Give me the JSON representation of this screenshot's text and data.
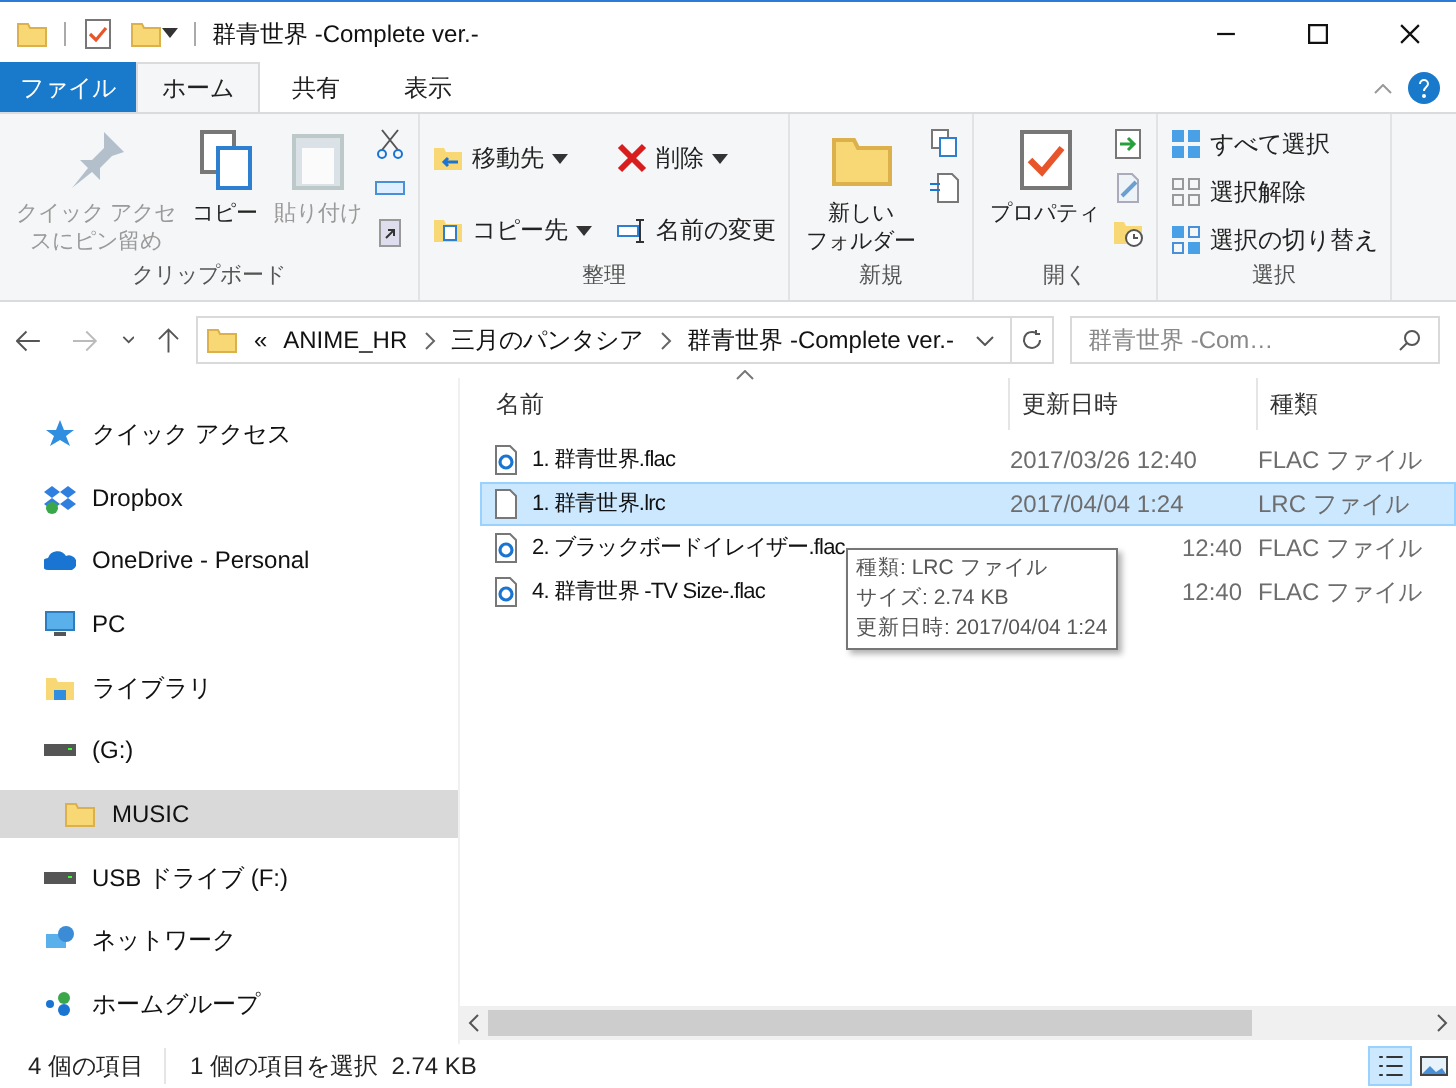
{
  "window": {
    "title": "群青世界 -Complete ver.-"
  },
  "ribbon_tabs": [
    {
      "label": "ファイル",
      "kind": "file",
      "selected": false
    },
    {
      "label": "ホーム",
      "kind": "tab",
      "selected": true
    },
    {
      "label": "共有",
      "kind": "tab",
      "selected": false
    },
    {
      "label": "表示",
      "kind": "tab",
      "selected": false
    }
  ],
  "ribbon_groups": [
    {
      "label": "クリップボード",
      "items": [
        {
          "kind": "large",
          "lines": [
            "クイック アクセ",
            "スにピン留め"
          ],
          "disabled": true
        },
        {
          "kind": "large",
          "lines": [
            "コピー"
          ],
          "disabled": false
        },
        {
          "kind": "large",
          "lines": [
            "貼り付け"
          ],
          "disabled": true
        }
      ]
    },
    {
      "label": "整理",
      "items": [
        {
          "kind": "small",
          "label": "移動先",
          "dropdown": true
        },
        {
          "kind": "small",
          "label": "削除",
          "dropdown": true
        },
        {
          "kind": "small",
          "label": "コピー先",
          "dropdown": true
        },
        {
          "kind": "small",
          "label": "名前の変更",
          "dropdown": false
        }
      ]
    },
    {
      "label": "新規",
      "items": [
        {
          "kind": "large",
          "lines": [
            "新しい",
            "フォルダー"
          ],
          "disabled": false
        }
      ]
    },
    {
      "label": "開く",
      "items": [
        {
          "kind": "large",
          "lines": [
            "プロパティ"
          ],
          "disabled": false
        }
      ]
    },
    {
      "label": "選択",
      "items": [
        {
          "kind": "small",
          "label": "すべて選択",
          "dropdown": false
        },
        {
          "kind": "small",
          "label": "選択解除",
          "dropdown": false
        },
        {
          "kind": "small",
          "label": "選択の切り替え",
          "dropdown": false
        }
      ]
    }
  ],
  "address": {
    "crumbs": [
      "«",
      "ANIME_HR",
      "三月のパンタシア",
      "群青世界 -Complete ver.-"
    ]
  },
  "search": {
    "placeholder": "群青世界 -Com…"
  },
  "sidebar": {
    "items": [
      {
        "label": "クイック アクセス",
        "selected": false
      },
      {
        "label": "Dropbox",
        "selected": false
      },
      {
        "label": "OneDrive - Personal",
        "selected": false
      },
      {
        "label": "PC",
        "selected": false
      },
      {
        "label": "ライブラリ",
        "selected": false
      },
      {
        "label": "(G:)",
        "selected": false,
        "children": [
          {
            "label": "MUSIC",
            "selected": true
          }
        ]
      },
      {
        "label": "USB ドライブ (F:)",
        "selected": false
      },
      {
        "label": "ネットワーク",
        "selected": false
      },
      {
        "label": "ホームグループ",
        "selected": false
      }
    ]
  },
  "table": {
    "columns": [
      "名前",
      "更新日時",
      "種類"
    ],
    "rows": [
      {
        "name": "1. 群青世界.flac",
        "date": "2017/03/26 12:40",
        "type": "FLAC ファイル",
        "kind": "audio",
        "selected": false
      },
      {
        "name": "1. 群青世界.lrc",
        "date": "2017/04/04 1:24",
        "type": "LRC ファイル",
        "kind": "text",
        "selected": true
      },
      {
        "name": "2. ブラックボードイレイザー.flac",
        "date": "12:40",
        "type": "FLAC ファイル",
        "kind": "audio",
        "selected": false
      },
      {
        "name": "4. 群青世界 -TV Size-.flac",
        "date": "12:40",
        "type": "FLAC ファイル",
        "kind": "audio",
        "selected": false
      }
    ]
  },
  "tooltip": {
    "lines": [
      "種類: LRC ファイル",
      "サイズ: 2.74 KB",
      "更新日時: 2017/04/04 1:24"
    ]
  },
  "status_bar": {
    "count": "4 個の項目",
    "selection": "1 個の項目を選択  2.74 KB"
  }
}
